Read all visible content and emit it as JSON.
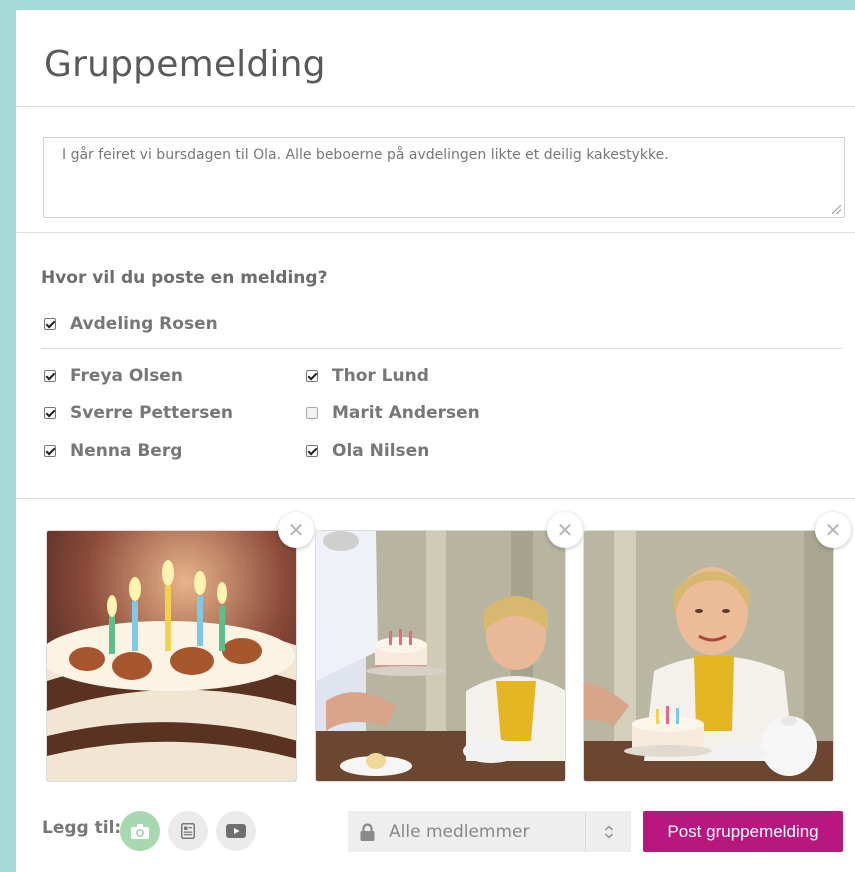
{
  "title": "Gruppemelding",
  "message": {
    "text": "I går feiret vi bursdagen til Ola. Alle beboerne på avdelingen likte et deilig kakestykke."
  },
  "audience": {
    "question": "Hvor vil du poste en melding?",
    "department": {
      "label": "Avdeling Rosen",
      "checked": true
    },
    "members": [
      {
        "label": "Freya Olsen",
        "checked": true
      },
      {
        "label": "Thor Lund",
        "checked": true
      },
      {
        "label": "Sverre Pettersen",
        "checked": true
      },
      {
        "label": "Marit Andersen",
        "checked": false
      },
      {
        "label": "Nenna Berg",
        "checked": true
      },
      {
        "label": "Ola Nilsen",
        "checked": true
      }
    ]
  },
  "attachments": {
    "remove_symbol": "✕",
    "photos": [
      {
        "icon": "birthday-cake-photo"
      },
      {
        "icon": "cake-served-photo"
      },
      {
        "icon": "woman-with-cake-photo"
      }
    ]
  },
  "footer": {
    "add_label": "Legg til:",
    "add_buttons": [
      {
        "icon": "camera-icon",
        "active": true
      },
      {
        "icon": "document-icon",
        "active": false
      },
      {
        "icon": "video-icon",
        "active": false
      }
    ],
    "visibility_select": {
      "value": "Alle medlemmer",
      "icon": "lock-icon"
    },
    "post_button": "Post gruppemelding"
  },
  "colors": {
    "background": "#a3d9d6",
    "accent": "#b7177e",
    "active_add_button": "#a8d8b0",
    "inactive_add_button": "#ebebeb"
  }
}
